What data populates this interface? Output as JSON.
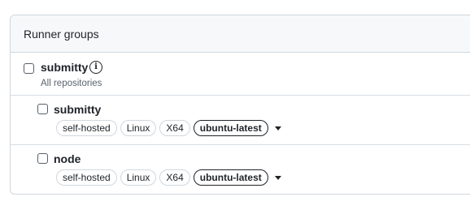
{
  "panel": {
    "title": "Runner groups"
  },
  "group": {
    "name": "submitty",
    "access": "All repositories"
  },
  "runners": [
    {
      "name": "submitty",
      "labels": [
        "self-hosted",
        "Linux",
        "X64"
      ],
      "selected_label": "ubuntu-latest"
    },
    {
      "name": "node",
      "labels": [
        "self-hosted",
        "Linux",
        "X64"
      ],
      "selected_label": "ubuntu-latest"
    }
  ],
  "icons": {
    "info": "info-icon",
    "dropdown": "triangle-down-icon"
  }
}
